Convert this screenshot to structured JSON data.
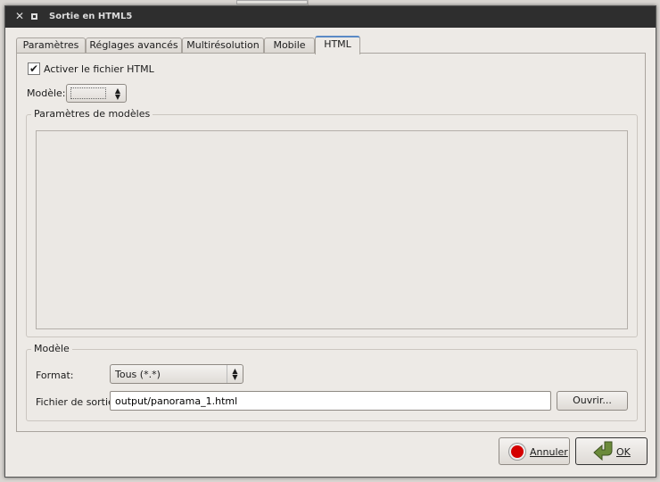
{
  "window": {
    "title": "Sortie en HTML5"
  },
  "tabs": [
    {
      "label": "Paramètres"
    },
    {
      "label": "Réglages avancés"
    },
    {
      "label": "Multirésolution"
    },
    {
      "label": "Mobile"
    },
    {
      "label": "HTML",
      "active": true
    }
  ],
  "html_tab": {
    "enable_checkbox": {
      "label": "Activer le fichier HTML",
      "checked": true
    },
    "template_label": "Modèle:",
    "template_value": "",
    "template_params_group": "Paramètres de modèles",
    "model_group": {
      "title": "Modèle",
      "format_label": "Format:",
      "format_value": "Tous (*.*)",
      "output_label": "Fichier de sortie:",
      "output_value": "output/panorama_1.html",
      "open_button": "Ouvrir..."
    }
  },
  "buttons": {
    "cancel": "Annuler",
    "ok": "OK"
  },
  "colors": {
    "titlebar": "#2e2e2e",
    "active_tab_accent": "#5a8ac6",
    "cancel_icon": "#d40000",
    "ok_icon": "#6b8a3a"
  }
}
